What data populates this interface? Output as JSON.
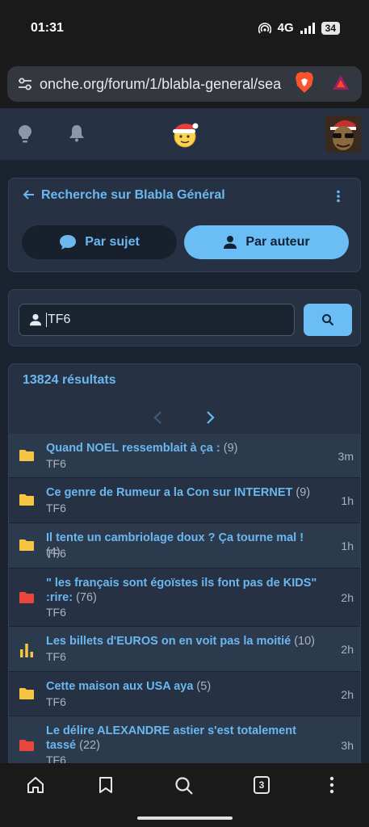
{
  "status_bar": {
    "time": "01:31",
    "network": "4G",
    "battery": "34"
  },
  "browser": {
    "url": "onche.org/forum/1/blabla-general/sea"
  },
  "search_card": {
    "title": "Recherche sur Blabla Général",
    "tab_subject": "Par sujet",
    "tab_author": "Par auteur",
    "active_tab": "Par auteur"
  },
  "search": {
    "value": "TF6"
  },
  "results": {
    "count_label": "13824 résultats",
    "topics": [
      {
        "title": "Quand NOEL ressemblait à ça :",
        "count": "(9)",
        "author": "TF6",
        "time": "3m",
        "icon": "folder-icon",
        "icon_color": "#f6c544"
      },
      {
        "title": "Ce genre de Rumeur a la Con sur INTERNET",
        "count": "(9)",
        "author": "TF6",
        "time": "1h",
        "icon": "folder-icon",
        "icon_color": "#f6c544"
      },
      {
        "title": "Il tente un cambriolage doux ? Ça tourne mal !",
        "count": "(4)",
        "author": "TF6",
        "time": "1h",
        "icon": "folder-icon",
        "icon_color": "#f6c544"
      },
      {
        "title": "\" les français sont égoïstes ils font pas de KIDS\" :rire:",
        "count": "(76)",
        "author": "TF6",
        "time": "2h",
        "icon": "folder-icon",
        "icon_color": "#e8453c"
      },
      {
        "title": "Les billets d'EUROS on en voit pas la moitié",
        "count": "(10)",
        "author": "TF6",
        "time": "2h",
        "icon": "poll-icon",
        "icon_color": "#f6c544"
      },
      {
        "title": "Cette maison aux USA aya",
        "count": "(5)",
        "author": "TF6",
        "time": "2h",
        "icon": "folder-icon",
        "icon_color": "#f6c544"
      },
      {
        "title": "Le délire ALEXANDRE astier s'est totalement tassé",
        "count": "(22)",
        "author": "TF6",
        "time": "3h",
        "icon": "folder-icon",
        "icon_color": "#e8453c"
      }
    ]
  },
  "bottom_nav": {
    "tabs_count": "3"
  },
  "colors": {
    "accent": "#6bb7f0",
    "background": "#1b2330",
    "card": "#263243"
  }
}
